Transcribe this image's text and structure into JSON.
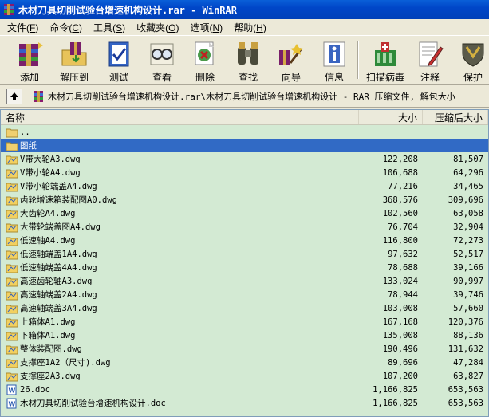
{
  "window": {
    "title": "木材刀具切削试验台增速机构设计.rar - WinRAR"
  },
  "menu": [
    {
      "label": "文件",
      "key": "F"
    },
    {
      "label": "命令",
      "key": "C"
    },
    {
      "label": "工具",
      "key": "S"
    },
    {
      "label": "收藏夹",
      "key": "O"
    },
    {
      "label": "选项",
      "key": "N"
    },
    {
      "label": "帮助",
      "key": "H"
    }
  ],
  "toolbar": {
    "add": "添加",
    "extract": "解压到",
    "test": "测试",
    "view": "查看",
    "delete": "删除",
    "find": "查找",
    "wizard": "向导",
    "info": "信息",
    "virus": "扫描病毒",
    "comment": "注释",
    "protect": "保护"
  },
  "path": {
    "text": "木材刀具切削试验台增速机构设计.rar\\木材刀具切削试验台增速机构设计 - RAR 压缩文件, 解包大小"
  },
  "columns": {
    "name": "名称",
    "size": "大小",
    "packed": "压缩后大小"
  },
  "files": [
    {
      "name": "..",
      "size": "",
      "packed": "",
      "type": "folder"
    },
    {
      "name": "图纸",
      "size": "",
      "packed": "",
      "type": "folder",
      "selected": true
    },
    {
      "name": "V带大轮A3.dwg",
      "size": "122,208",
      "packed": "81,507",
      "type": "dwg"
    },
    {
      "name": "V带小轮A4.dwg",
      "size": "106,688",
      "packed": "64,296",
      "type": "dwg"
    },
    {
      "name": "V带小轮端盖A4.dwg",
      "size": "77,216",
      "packed": "34,465",
      "type": "dwg"
    },
    {
      "name": "齿轮增速箱装配图A0.dwg",
      "size": "368,576",
      "packed": "309,696",
      "type": "dwg"
    },
    {
      "name": "大齿轮A4.dwg",
      "size": "102,560",
      "packed": "63,058",
      "type": "dwg"
    },
    {
      "name": "大带轮端盖图A4.dwg",
      "size": "76,704",
      "packed": "32,904",
      "type": "dwg"
    },
    {
      "name": "低速轴A4.dwg",
      "size": "116,800",
      "packed": "72,273",
      "type": "dwg"
    },
    {
      "name": "低速轴端盖1A4.dwg",
      "size": "97,632",
      "packed": "52,517",
      "type": "dwg"
    },
    {
      "name": "低速轴端盖4A4.dwg",
      "size": "78,688",
      "packed": "39,166",
      "type": "dwg"
    },
    {
      "name": "高速齿轮轴A3.dwg",
      "size": "133,024",
      "packed": "90,997",
      "type": "dwg"
    },
    {
      "name": "高速轴端盖2A4.dwg",
      "size": "78,944",
      "packed": "39,746",
      "type": "dwg"
    },
    {
      "name": "高速轴端盖3A4.dwg",
      "size": "103,008",
      "packed": "57,660",
      "type": "dwg"
    },
    {
      "name": "上箱体A1.dwg",
      "size": "167,168",
      "packed": "120,376",
      "type": "dwg"
    },
    {
      "name": "下箱体A1.dwg",
      "size": "135,008",
      "packed": "88,136",
      "type": "dwg"
    },
    {
      "name": "整体装配图.dwg",
      "size": "190,496",
      "packed": "131,632",
      "type": "dwg"
    },
    {
      "name": "支撑座1A2（尺寸).dwg",
      "size": "89,696",
      "packed": "47,284",
      "type": "dwg"
    },
    {
      "name": "支撑座2A3.dwg",
      "size": "107,200",
      "packed": "63,827",
      "type": "dwg"
    },
    {
      "name": "26.doc",
      "size": "1,166,825",
      "packed": "653,563",
      "type": "doc"
    },
    {
      "name": "木材刀具切削试验台增速机构设计.doc",
      "size": "1,166,825",
      "packed": "653,563",
      "type": "doc"
    }
  ]
}
